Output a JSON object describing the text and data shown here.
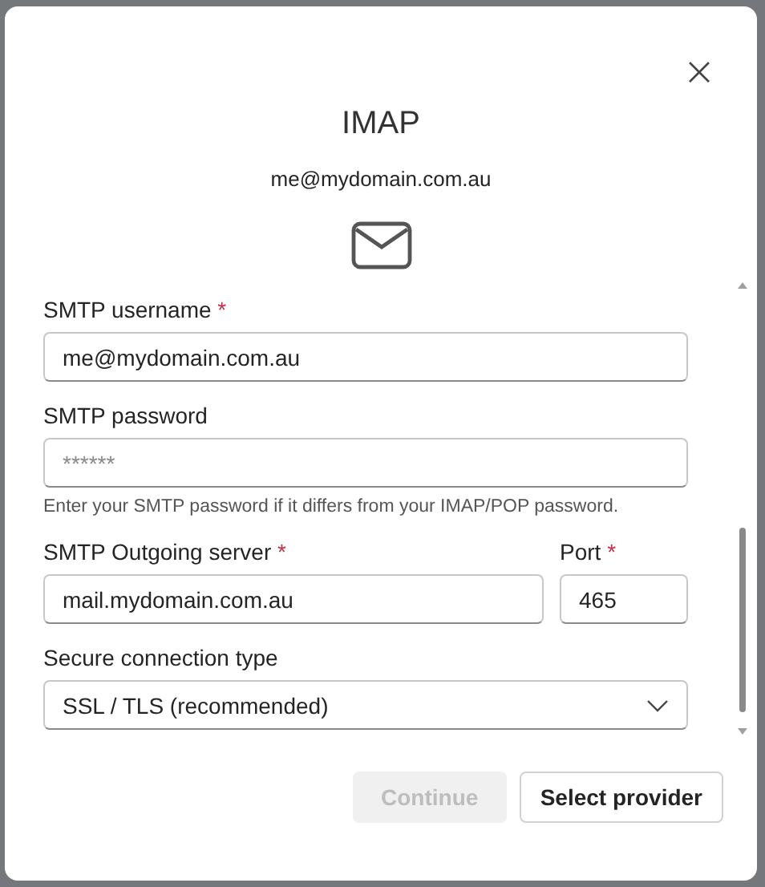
{
  "dialog": {
    "title": "IMAP",
    "account": "me@mydomain.com.au"
  },
  "fields": [
    {
      "kind": "text",
      "label": "SMTP username",
      "required": true,
      "mark": "*",
      "value": "me@mydomain.com.au"
    },
    {
      "kind": "password",
      "label": "SMTP password",
      "placeholder": "******",
      "help": "Enter your SMTP password if it differs from your IMAP/POP password."
    }
  ],
  "server_row": [
    {
      "label": "SMTP Outgoing server",
      "required": true,
      "mark": "*",
      "value": "mail.mydomain.com.au"
    },
    {
      "label": "Port",
      "required": true,
      "mark": "*",
      "value": "465"
    }
  ],
  "connection": {
    "label": "Secure connection type",
    "value": "SSL / TLS (recommended)"
  },
  "buttons": [
    {
      "label": "Continue",
      "disabled": true
    },
    {
      "label": "Select provider",
      "disabled": false
    }
  ]
}
